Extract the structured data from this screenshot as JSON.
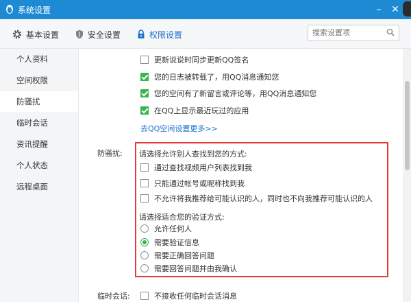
{
  "window": {
    "title": "系统设置",
    "minimize": "–",
    "close": "✕"
  },
  "search": {
    "placeholder": "搜索设置项"
  },
  "nav": {
    "tabs": [
      {
        "label": "基本设置"
      },
      {
        "label": "安全设置"
      },
      {
        "label": "权限设置"
      }
    ]
  },
  "sidebar": {
    "items": [
      {
        "label": "个人资料"
      },
      {
        "label": "空间权限"
      },
      {
        "label": "防骚扰"
      },
      {
        "label": "临时会话"
      },
      {
        "label": "资讯提醒"
      },
      {
        "label": "个人状态"
      },
      {
        "label": "远程桌面"
      }
    ]
  },
  "space": {
    "options": [
      {
        "label": "更新说说时同步更新QQ签名",
        "checked": false
      },
      {
        "label": "您的日志被转载了，用QQ消息通知您",
        "checked": true
      },
      {
        "label": "您的空间有了新留言或评论等，用QQ消息通知您",
        "checked": true
      },
      {
        "label": "在QQ上显示最近玩过的应用",
        "checked": true
      }
    ],
    "more_link": "去QQ空间设置更多>>"
  },
  "antispam": {
    "label": "防骚扰:",
    "find_title": "请选择允许别人查找到您的方式:",
    "find_options": [
      {
        "label": "通过查找视频用户列表找到我",
        "checked": false
      },
      {
        "label": "只能通过帐号或昵称找到我",
        "checked": false
      },
      {
        "label": "不允许将我推荐给可能认识的人，同时也不向我推荐可能认识的人",
        "checked": false
      }
    ],
    "verify_title": "请选择适合您的验证方式:",
    "verify_options": [
      {
        "label": "允许任何人",
        "selected": false
      },
      {
        "label": "需要验证信息",
        "selected": true
      },
      {
        "label": "需要正确回答问题",
        "selected": false
      },
      {
        "label": "需要回答问题并由我确认",
        "selected": false
      }
    ]
  },
  "temp_session": {
    "label": "临时会话:",
    "option": {
      "label": "不接收任何临时会话消息",
      "checked": false
    }
  },
  "colors": {
    "accent": "#1f8ad4",
    "check_green": "#39b54a",
    "highlight_red": "#e43a3a",
    "link_blue": "#1a73c9"
  }
}
